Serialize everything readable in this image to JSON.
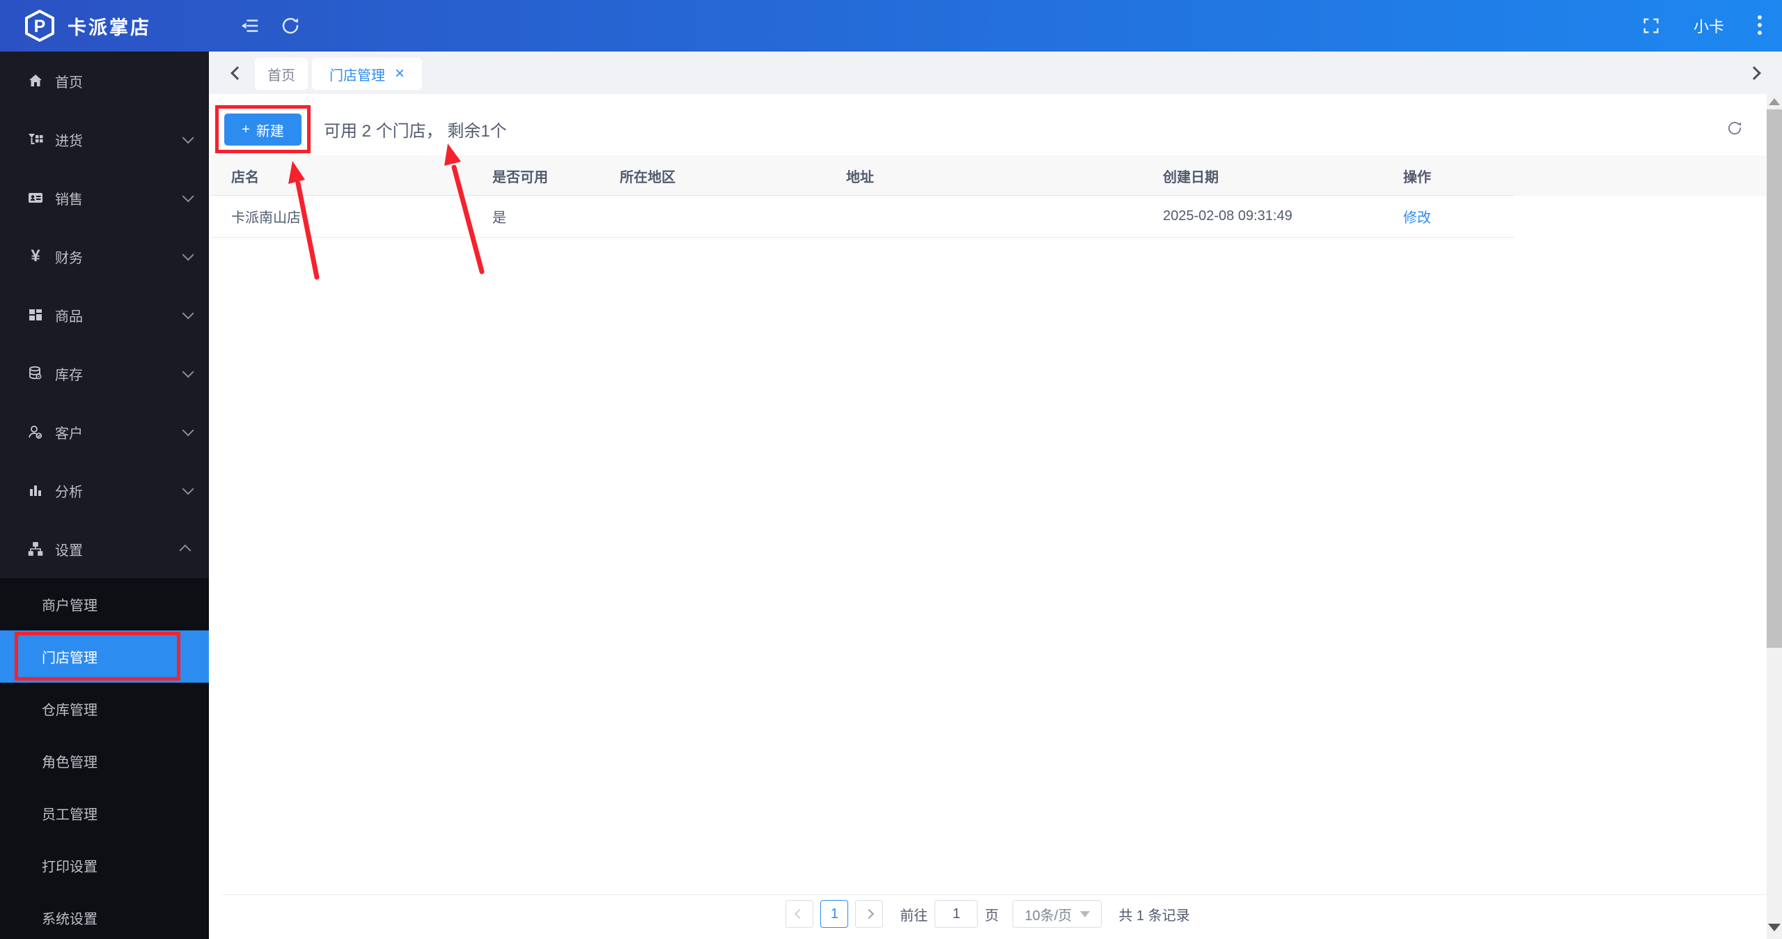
{
  "colors": {
    "primary": "#2d8cf0",
    "topbar_gradient_left": "#2b52c3",
    "topbar_gradient_right": "#1e87f0",
    "sidebar_bg": "#191a23",
    "submenu_bg": "#0e0f15",
    "annotation_red": "#f5222d",
    "table_header_bg": "#f8f8f9",
    "text_main": "#515a6e"
  },
  "topbar": {
    "brand": "卡派掌店",
    "logo_letter": "P",
    "user": "小卡"
  },
  "sidebar": {
    "items": [
      {
        "label": "首页",
        "icon": "home-icon"
      },
      {
        "label": "进货",
        "icon": "purchase-icon"
      },
      {
        "label": "销售",
        "icon": "sales-icon"
      },
      {
        "label": "财务",
        "icon": "finance-icon",
        "glyph": "¥"
      },
      {
        "label": "商品",
        "icon": "goods-icon"
      },
      {
        "label": "库存",
        "icon": "inventory-icon"
      },
      {
        "label": "客户",
        "icon": "customers-icon"
      },
      {
        "label": "分析",
        "icon": "analysis-icon"
      },
      {
        "label": "设置",
        "icon": "settings-icon"
      }
    ],
    "submenu": [
      {
        "label": "商户管理"
      },
      {
        "label": "门店管理",
        "active": true
      },
      {
        "label": "仓库管理"
      },
      {
        "label": "角色管理"
      },
      {
        "label": "员工管理"
      },
      {
        "label": "打印设置"
      },
      {
        "label": "系统设置"
      }
    ]
  },
  "tabs": {
    "back_tab": "首页",
    "active_tab": "门店管理",
    "close_glyph": "×"
  },
  "toolbar": {
    "new_label": "新建",
    "plus_glyph": "+",
    "quota_text": "可用 2 个门店， 剩余1个"
  },
  "table": {
    "columns": [
      "店名",
      "是否可用",
      "所在地区",
      "地址",
      "创建日期",
      "操作"
    ],
    "rows": [
      {
        "name": "卡派南山店",
        "available": "是",
        "region": "",
        "address": "",
        "created": "2025-02-08 09:31:49",
        "action": "修改"
      }
    ]
  },
  "pagination": {
    "current_page": "1",
    "goto_label": "前往",
    "goto_value": "1",
    "page_unit": "页",
    "page_size": "10条/页",
    "total_text": "共 1 条记录"
  }
}
